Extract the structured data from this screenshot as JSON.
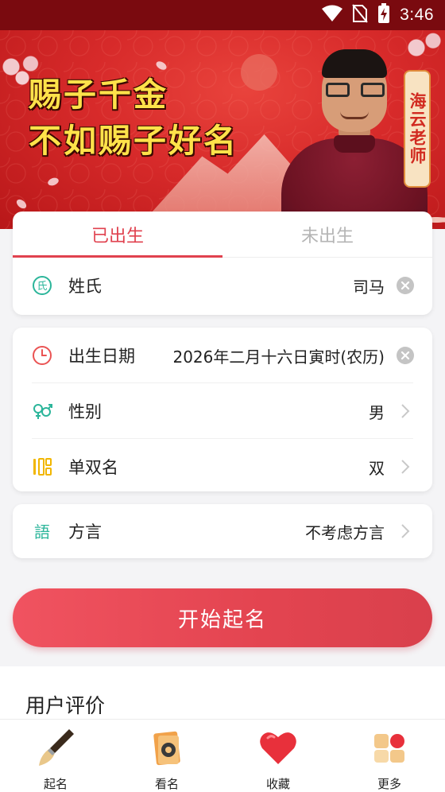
{
  "status_bar": {
    "time": "3:46"
  },
  "banner": {
    "slogan_line1": "赐子千金",
    "slogan_line2": "不如赐子好名",
    "teacher_tag": "海云老师"
  },
  "birth_tabs": [
    {
      "label": "已出生",
      "active": true
    },
    {
      "label": "未出生",
      "active": false
    }
  ],
  "surname_row": {
    "label": "姓氏",
    "value": "司马"
  },
  "birth_date_row": {
    "label": "出生日期",
    "value": "2026年二月十六日寅时(农历)"
  },
  "gender_row": {
    "label": "性别",
    "value": "男"
  },
  "name_length_row": {
    "label": "单双名",
    "value": "双"
  },
  "dialect_row": {
    "label": "方言",
    "value": "不考虑方言"
  },
  "start_button": {
    "label": "开始起名"
  },
  "reviews": {
    "title": "用户评价"
  },
  "bottom_nav": [
    {
      "label": "起名",
      "icon": "brush-icon"
    },
    {
      "label": "看名",
      "icon": "name-card-icon"
    },
    {
      "label": "收藏",
      "icon": "heart-icon"
    },
    {
      "label": "更多",
      "icon": "more-grid-icon"
    }
  ],
  "colors": {
    "accent": "#e0424f",
    "status_bar": "#7a0a0f",
    "banner_red": "#d72a2a",
    "icon_green": "#2bb59a",
    "icon_red": "#ea5353",
    "icon_yellow": "#f1b600"
  }
}
